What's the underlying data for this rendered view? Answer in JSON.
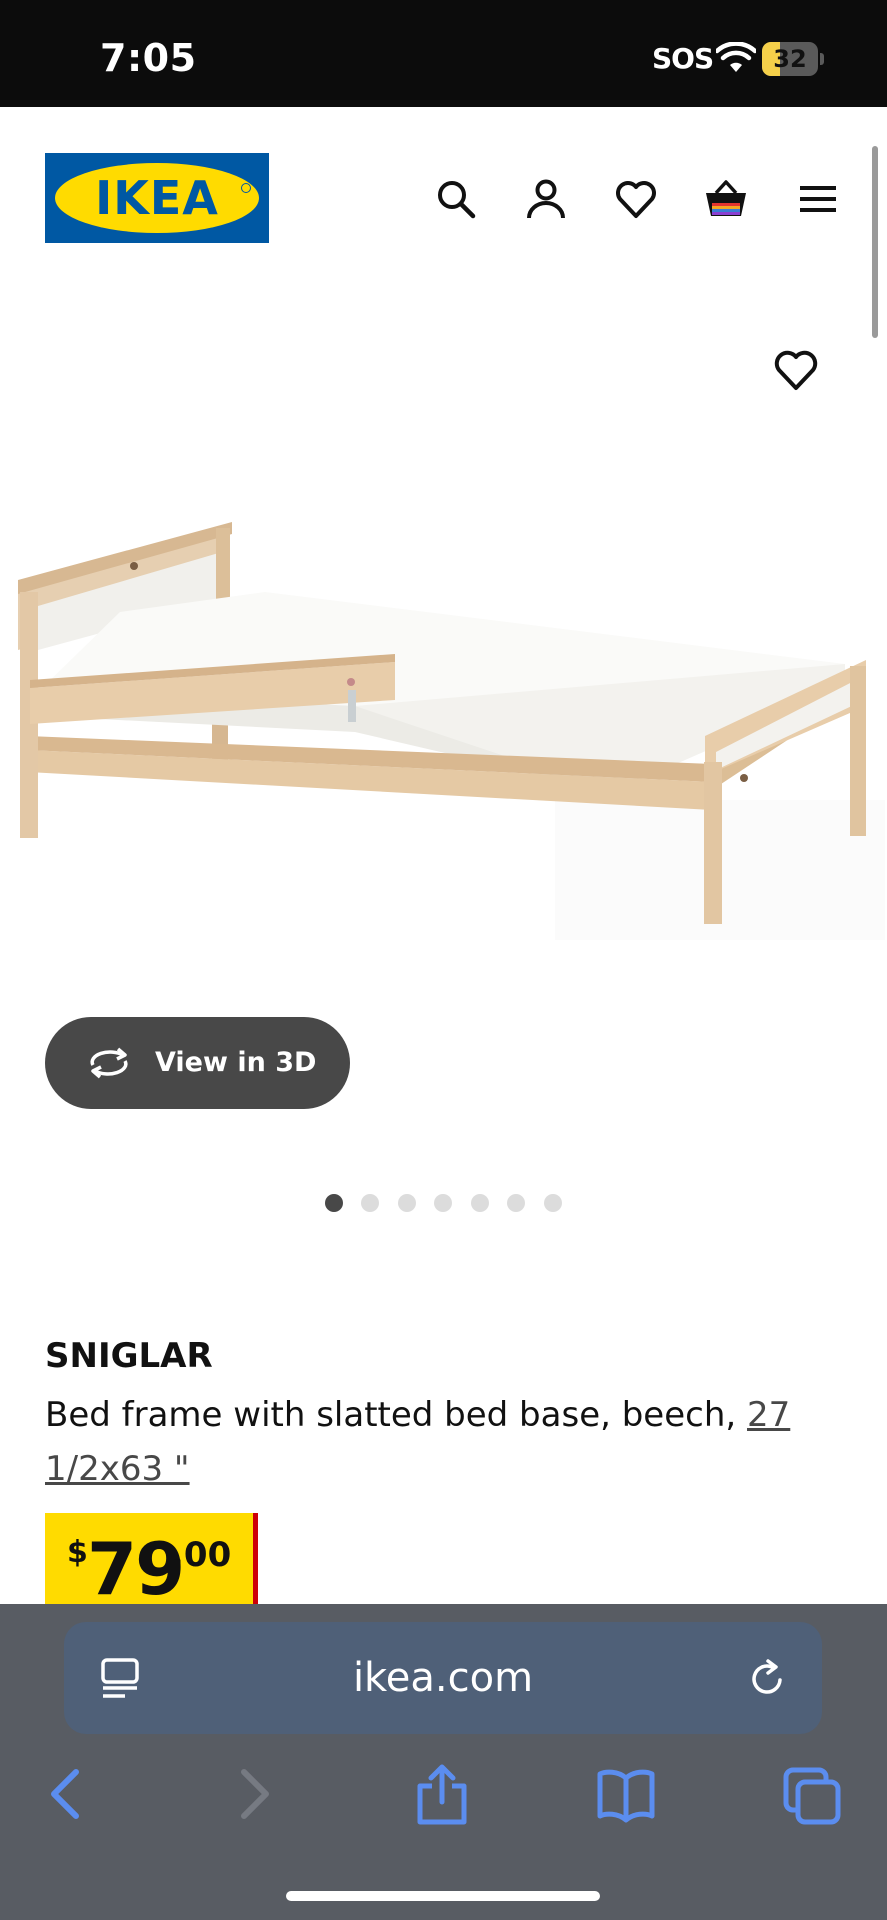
{
  "status_bar": {
    "time": "7:05",
    "carrier": "SOS",
    "battery_level": "32",
    "battery_fraction": 0.32
  },
  "header": {
    "logo_text": "IKEA",
    "icons": [
      "search-icon",
      "account-icon",
      "favorites-icon",
      "cart-icon",
      "menu-icon"
    ]
  },
  "product": {
    "image_alt": "SNIGLAR bed frame",
    "view3d_label": "View in 3D",
    "gallery": {
      "count": 7,
      "active_index": 0
    },
    "name": "SNIGLAR",
    "description": "Bed frame with slatted bed base, beech,",
    "size": "27 1/2x63 \"",
    "price": {
      "currency": "$",
      "whole": "79",
      "cents": ".00"
    }
  },
  "browser": {
    "url": "ikea.com"
  },
  "colors": {
    "ikea_blue": "#0058a3",
    "ikea_yellow": "#ffdb00",
    "price_accent": "#cc0008",
    "safari_accent": "#5b8def"
  }
}
